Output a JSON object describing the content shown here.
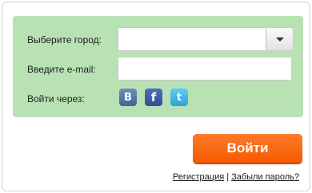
{
  "form": {
    "city_label": "Выберите город:",
    "city_value": "",
    "email_label": "Введите e-mail:",
    "email_value": "",
    "email_placeholder": "",
    "social_label": "Войти через:"
  },
  "social": [
    {
      "name": "vkontakte",
      "glyph": "B",
      "icon": "vk-icon",
      "color": "#4a76a8"
    },
    {
      "name": "facebook",
      "glyph": "f",
      "icon": "facebook-icon",
      "color": "#3b5998"
    },
    {
      "name": "twitter",
      "glyph": "t",
      "icon": "twitter-icon",
      "color": "#55acee"
    }
  ],
  "actions": {
    "login_label": "Войти",
    "register_link": "Регистрация",
    "separator": "|",
    "forgot_link": "Забыли пароль?"
  },
  "colors": {
    "panel_bg": "#b8e2b3",
    "login_button": "#f8660f"
  }
}
